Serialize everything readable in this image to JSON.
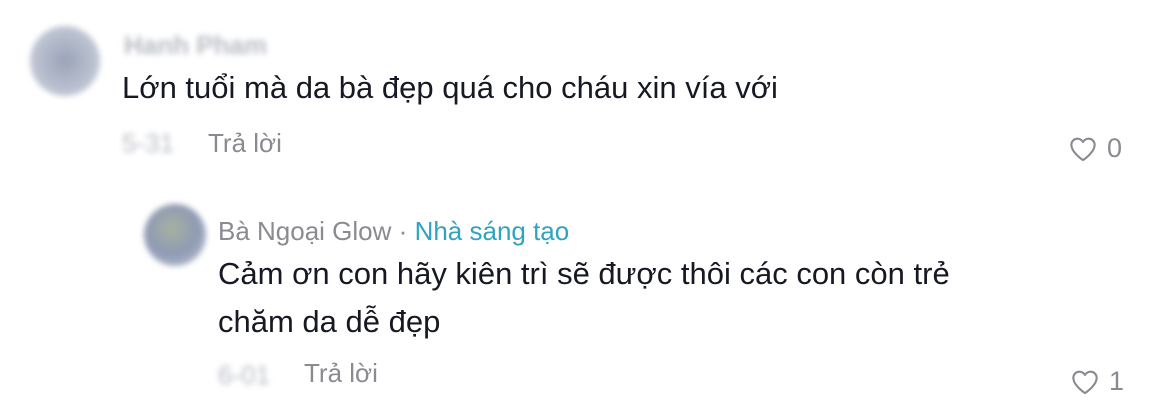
{
  "comment": {
    "author_name_blurred": "Hanh Pham",
    "text": "Lớn tuổi mà da bà đẹp quá cho cháu xin vía với",
    "date_blurred": "5-31",
    "reply_label": "Trả lời",
    "like_count": "0",
    "icons": {
      "like": "heart-outline-icon"
    }
  },
  "reply": {
    "author_name": "Bà Ngoại Glow",
    "separator": "·",
    "creator_badge": "Nhà sáng tạo",
    "text_line1": "Cảm ơn con hãy kiên trì sẽ được thôi các con còn trẻ",
    "text_line2": "chăm da dễ đẹp",
    "date_blurred": "6-01",
    "reply_label": "Trả lời",
    "like_count": "1",
    "icons": {
      "like": "heart-outline-icon"
    }
  },
  "colors": {
    "creator_badge": "#2fa3c0",
    "secondary_text": "#8a8b91",
    "primary_text": "#161823"
  }
}
